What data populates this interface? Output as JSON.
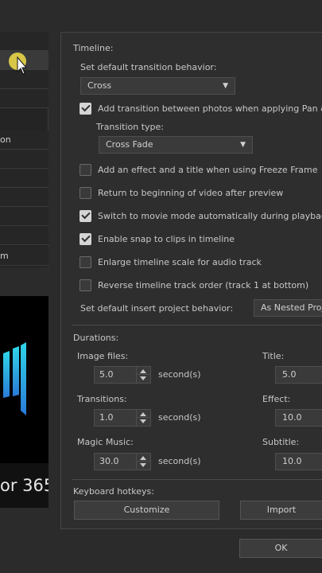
{
  "sidebar": {
    "items": [
      {
        "label": ""
      },
      {
        "label": ""
      },
      {
        "label": ""
      },
      {
        "label": ""
      },
      {
        "label": "on"
      },
      {
        "label": ""
      },
      {
        "label": ""
      },
      {
        "label": ""
      },
      {
        "label": ""
      },
      {
        "label": ""
      },
      {
        "label": ""
      },
      {
        "label": "m"
      }
    ]
  },
  "brand": {
    "suffix": "or 365"
  },
  "timeline": {
    "section_title": "Timeline:",
    "transition_behavior_label": "Set default transition behavior:",
    "transition_behavior_value": "Cross",
    "add_transition_label": "Add transition between photos when applying Pan & Z",
    "add_transition_checked": true,
    "transition_type_label": "Transition type:",
    "transition_type_value": "Cross Fade",
    "options": [
      {
        "label": "Add an effect and a title when using Freeze Frame",
        "checked": false
      },
      {
        "label": "Return to beginning of video after preview",
        "checked": false
      },
      {
        "label": "Switch to movie mode automatically during playback",
        "checked": true
      },
      {
        "label": "Enable snap to clips in timeline",
        "checked": true
      },
      {
        "label": "Enlarge timeline scale for audio track",
        "checked": false
      },
      {
        "label": "Reverse timeline track order (track 1 at bottom)",
        "checked": false
      }
    ],
    "insert_behavior_label": "Set default insert project behavior:",
    "insert_behavior_value": "As Nested Proj"
  },
  "durations": {
    "section_title": "Durations:",
    "image_files_label": "Image files:",
    "image_files_value": "5.0",
    "transitions_label": "Transitions:",
    "transitions_value": "1.0",
    "magic_music_label": "Magic Music:",
    "magic_music_value": "30.0",
    "unit": "second(s)",
    "title_label": "Title:",
    "title_value": "5.0",
    "effect_label": "Effect:",
    "effect_value": "10.0",
    "subtitle_label": "Subtitle:",
    "subtitle_value": "10.0"
  },
  "hotkeys": {
    "section_title": "Keyboard hotkeys:",
    "customize_label": "Customize",
    "import_label": "Import"
  },
  "footer": {
    "ok_label": "OK"
  },
  "icons": {
    "cursor": "mouse-pointer-icon",
    "logo": "app-logo-icon",
    "dropdown": "chevron-down-icon"
  },
  "colors": {
    "logo_start": "#2fd6e8",
    "logo_end": "#2a7ad8",
    "cursor_highlight": "#f5e14a"
  }
}
